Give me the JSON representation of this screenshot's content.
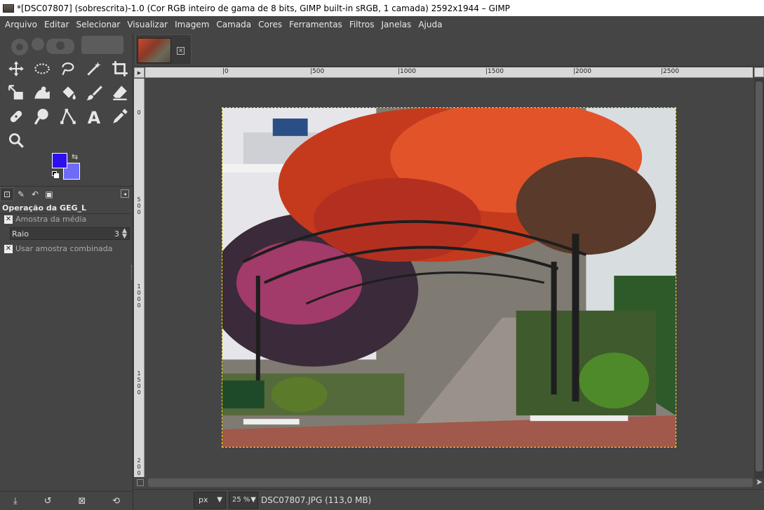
{
  "window": {
    "title": "*[DSC07807] (sobrescrita)-1.0 (Cor RGB inteiro de gama de 8 bits, GIMP built-in sRGB, 1 camada) 2592x1944 – GIMP"
  },
  "menu": [
    "Arquivo",
    "Editar",
    "Selecionar",
    "Visualizar",
    "Imagem",
    "Camada",
    "Cores",
    "Ferramentas",
    "Filtros",
    "Janelas",
    "Ajuda"
  ],
  "tools": [
    {
      "name": "move-tool-icon"
    },
    {
      "name": "ellipse-select-icon"
    },
    {
      "name": "free-select-lasso-icon"
    },
    {
      "name": "fuzzy-select-wand-icon"
    },
    {
      "name": "crop-tool-icon"
    },
    {
      "name": "unified-transform-icon"
    },
    {
      "name": "warp-transform-icon"
    },
    {
      "name": "bucket-fill-icon"
    },
    {
      "name": "paintbrush-icon"
    },
    {
      "name": "eraser-icon"
    },
    {
      "name": "heal-tool-icon"
    },
    {
      "name": "smudge-tool-icon"
    },
    {
      "name": "paths-tool-icon"
    },
    {
      "name": "text-tool-icon"
    },
    {
      "name": "color-picker-icon"
    },
    {
      "name": "zoom-tool-icon"
    }
  ],
  "colors": {
    "foreground": "#2e0ff0",
    "background": "#6e6cf7"
  },
  "tool_options": {
    "title": "Operação da GEG_L",
    "sample_average": "Amostra da média",
    "radius_label": "Raio",
    "radius_value": "3",
    "sample_merged": "Usar amostra combinada"
  },
  "rulers": {
    "h_ticks": [
      "|0",
      "|500",
      "|1000",
      "|1500",
      "|2000",
      "|2500"
    ],
    "v_ticks": [
      "0",
      "500",
      "1000",
      "1500",
      "2000"
    ]
  },
  "status": {
    "unit": "px",
    "zoom": "25 %",
    "file_info": "DSC07807.JPG (113,0 MB)"
  }
}
